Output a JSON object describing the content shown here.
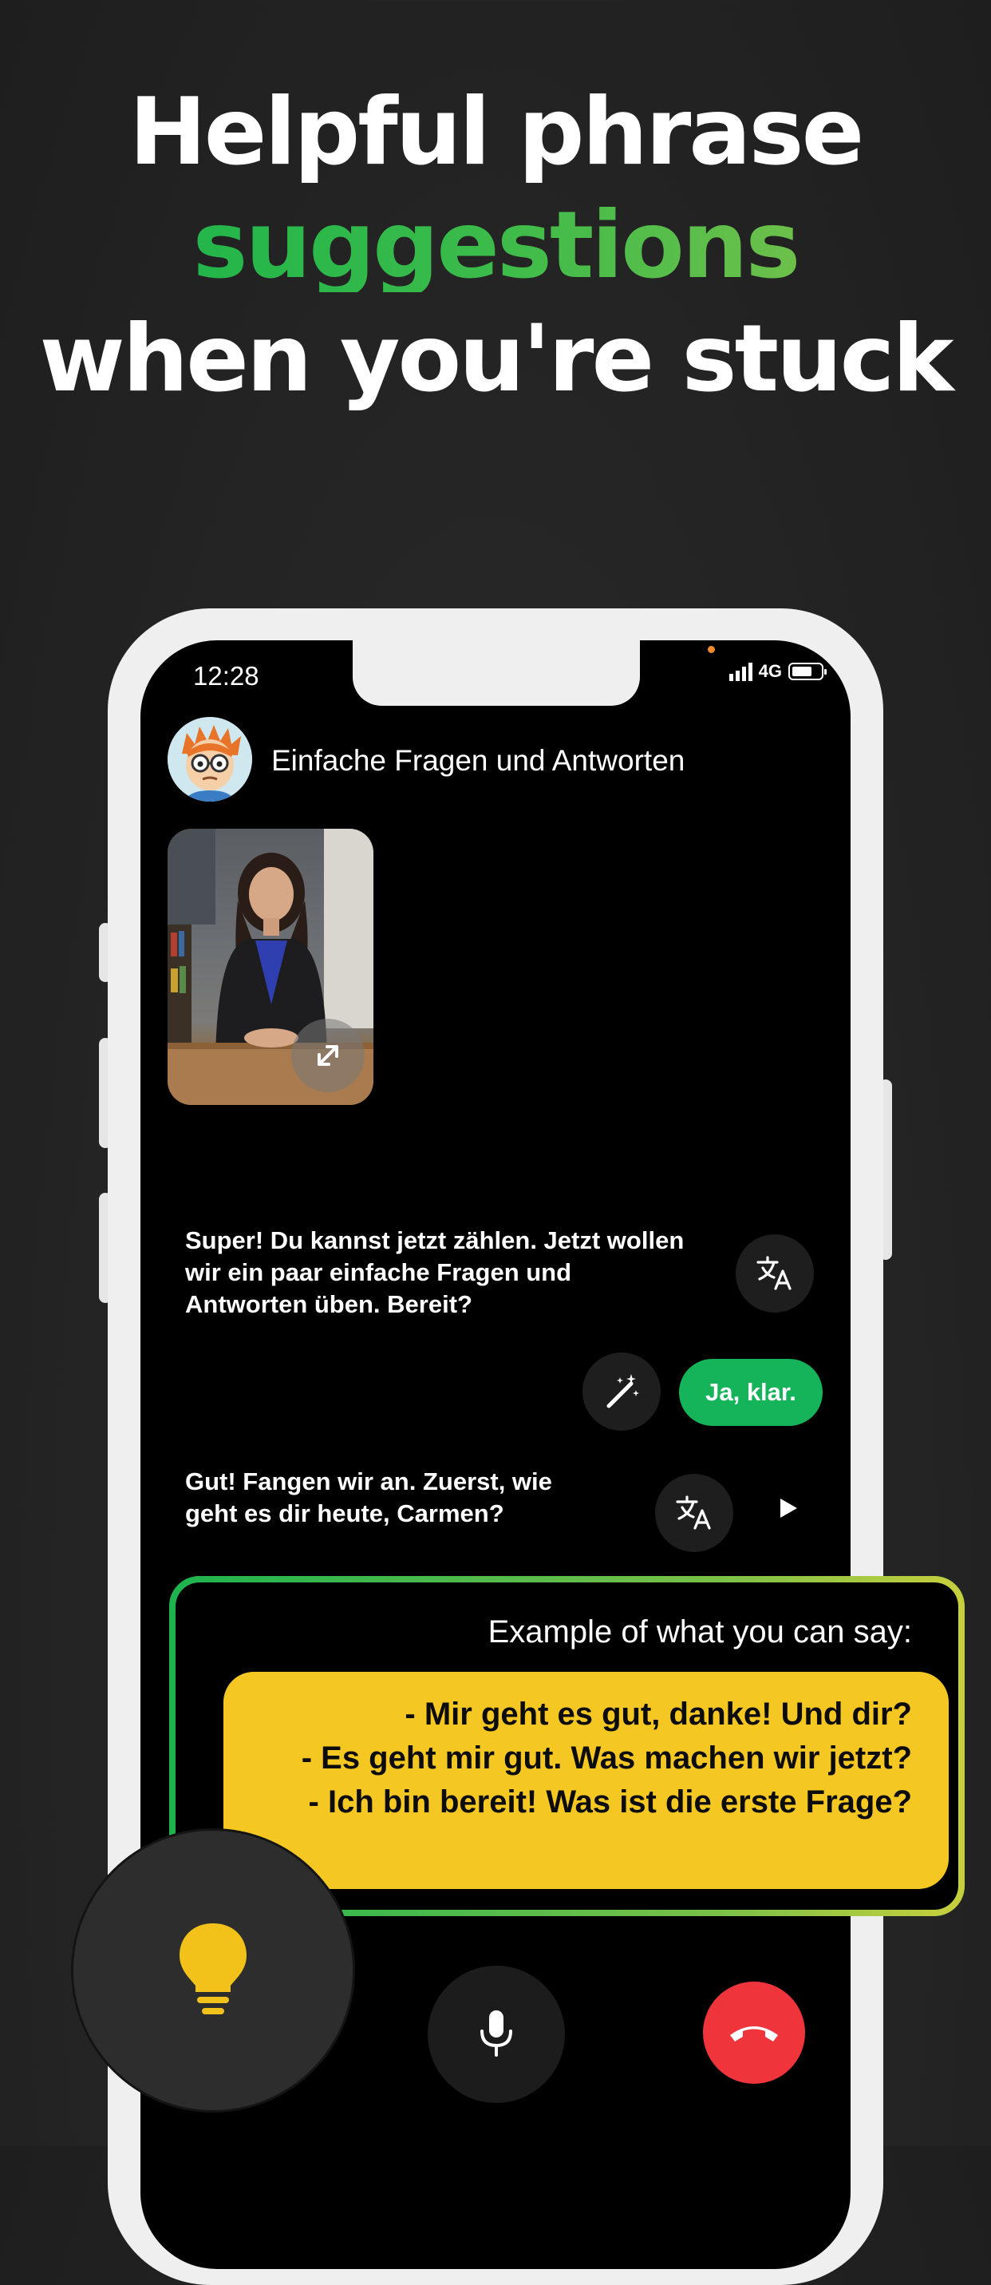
{
  "headline": {
    "line1": "Helpful phrase",
    "line2": "suggestions",
    "line3": "when you're stuck"
  },
  "status_bar": {
    "time": "12:28",
    "network": "4G"
  },
  "chat_header": {
    "title": "Einfache Fragen und Antworten"
  },
  "messages": [
    {
      "role": "tutor",
      "text": "Super! Du kannst jetzt zählen. Jetzt wollen wir ein paar einfache Fragen und Antworten üben. Bereit?"
    },
    {
      "role": "user",
      "text": "Ja, klar."
    },
    {
      "role": "tutor",
      "text": "Gut! Fangen wir an. Zuerst, wie geht es dir heute, Carmen?"
    }
  ],
  "suggestions": {
    "caption": "Example of what you can say:",
    "phrases": [
      "- Mir geht es gut, danke! Und dir?",
      "- Es geht mir gut. Was machen wir jetzt?",
      "- Ich bin bereit! Was ist die erste Frage?"
    ]
  },
  "icons": {
    "translate": "translate-icon",
    "magic": "magic-wand-icon",
    "play": "play-icon",
    "expand": "expand-icon",
    "mic": "microphone-icon",
    "hangup": "hang-up-icon",
    "hint": "lightbulb-icon"
  },
  "colors": {
    "accent_green": "#16b45a",
    "suggestion_yellow": "#f4c722",
    "hangup_red": "#f0343c",
    "hint_bulb": "#f2c21a"
  }
}
